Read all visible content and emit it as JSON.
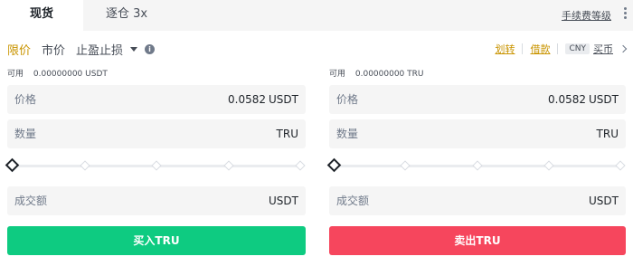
{
  "tabs": {
    "spot": "现货",
    "margin": "逐仓 3x"
  },
  "header": {
    "fee_link": "手续费等级"
  },
  "order_types": {
    "limit": "限价",
    "market": "市价",
    "stop_limit": "止盈止损"
  },
  "links": {
    "transfer": "划转",
    "borrow": "借款",
    "currency_badge": "CNY",
    "buy_coin": "买币"
  },
  "buy": {
    "available_label": "可用",
    "available_value": "0.00000000 USDT",
    "price_label": "价格",
    "price_value": "0.0582",
    "price_unit": "USDT",
    "amount_label": "数量",
    "amount_unit": "TRU",
    "total_label": "成交额",
    "total_unit": "USDT",
    "button": "买入TRU",
    "slider_percent": 0
  },
  "sell": {
    "available_label": "可用",
    "available_value": "0.00000000 TRU",
    "price_label": "价格",
    "price_value": "0.0582",
    "price_unit": "USDT",
    "amount_label": "数量",
    "amount_unit": "TRU",
    "total_label": "成交额",
    "total_unit": "USDT",
    "button": "卖出TRU",
    "slider_percent": 0
  },
  "colors": {
    "accent": "#c99400",
    "buy": "#0ecb81",
    "sell": "#f6465d"
  },
  "icons": {
    "more": "more-vertical-icon",
    "info": "info-icon",
    "caret": "caret-down-icon",
    "chevron": "chevron-right-icon"
  }
}
